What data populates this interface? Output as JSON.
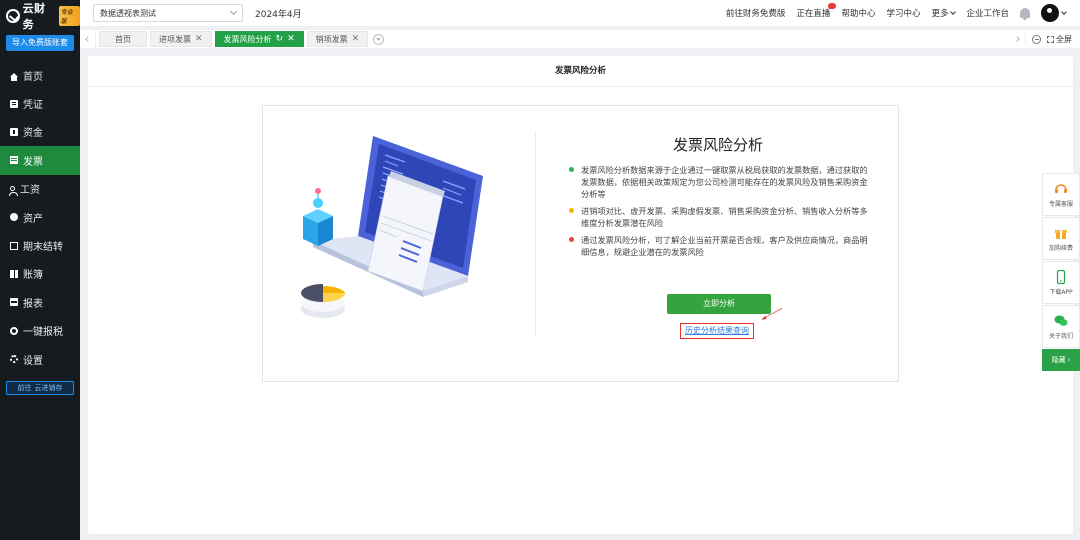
{
  "sidebar": {
    "brand": "云财务",
    "brand_badge": "专业版",
    "import_button": "导入免费版账套",
    "items": [
      {
        "label": "首页",
        "icon": "home-icon"
      },
      {
        "label": "凭证",
        "icon": "voucher-icon"
      },
      {
        "label": "资金",
        "icon": "money-icon"
      },
      {
        "label": "发票",
        "icon": "invoice-icon",
        "active": true
      },
      {
        "label": "工资",
        "icon": "salary-icon"
      },
      {
        "label": "资产",
        "icon": "asset-icon"
      },
      {
        "label": "期末结转",
        "icon": "period-close-icon"
      },
      {
        "label": "账簿",
        "icon": "ledger-icon"
      },
      {
        "label": "报表",
        "icon": "report-icon"
      },
      {
        "label": "一键报税",
        "icon": "tax-icon"
      },
      {
        "label": "设置",
        "icon": "settings-icon"
      }
    ],
    "goto_prefix": "前往",
    "goto_target": "云进销存"
  },
  "topbar": {
    "account_name": "数据透视表测试",
    "period": "2024年4月",
    "links": [
      "前往财务免费版",
      "正在直播",
      "帮助中心",
      "学习中心"
    ],
    "more": "更多",
    "workbench": "企业工作台"
  },
  "tabs": {
    "items": [
      {
        "label": "首页",
        "closable": false
      },
      {
        "label": "进项发票",
        "closable": true
      },
      {
        "label": "发票风险分析",
        "closable": true,
        "active": true
      },
      {
        "label": "销项发票",
        "closable": true
      }
    ],
    "fullscreen": "全屏"
  },
  "page": {
    "title": "发票风险分析",
    "card_title": "发票风险分析",
    "bullets": [
      {
        "color": "#2fb344",
        "text": "发票风险分析数据来源于企业通过一键取票从税局获取的发票数据，通过获取的发票数据，依据相关政策规定为您公司检测可能存在的发票风险及销售采购资金分析等"
      },
      {
        "color": "#f5b400",
        "text": "进销项对比、虚开发票、采购虚假发票、销售采购资金分析、销售收入分析等多维度分析发票潜在风险"
      },
      {
        "color": "#e8473c",
        "text": "通过发票风险分析，可了解企业当前开票是否合规，客户及供应商情况，商品明细信息，规避企业潜在的发票风险"
      }
    ],
    "analyze_button": "立即分析",
    "history_link": "历史分析结果查询"
  },
  "float_panel": {
    "items": [
      {
        "label": "专属客服",
        "icon": "headset-icon"
      },
      {
        "label": "加购续费",
        "icon": "gift-icon"
      },
      {
        "label": "下载APP",
        "icon": "phone-icon"
      },
      {
        "label": "关于我们",
        "icon": "wechat-icon"
      }
    ],
    "hide": "隐藏"
  },
  "colors": {
    "sidebar_bg": "#151b1e",
    "active_green": "#1f8a3d",
    "tab_active": "#23a146",
    "primary_blue": "#1c8be8",
    "highlight_red": "#e3301f"
  }
}
